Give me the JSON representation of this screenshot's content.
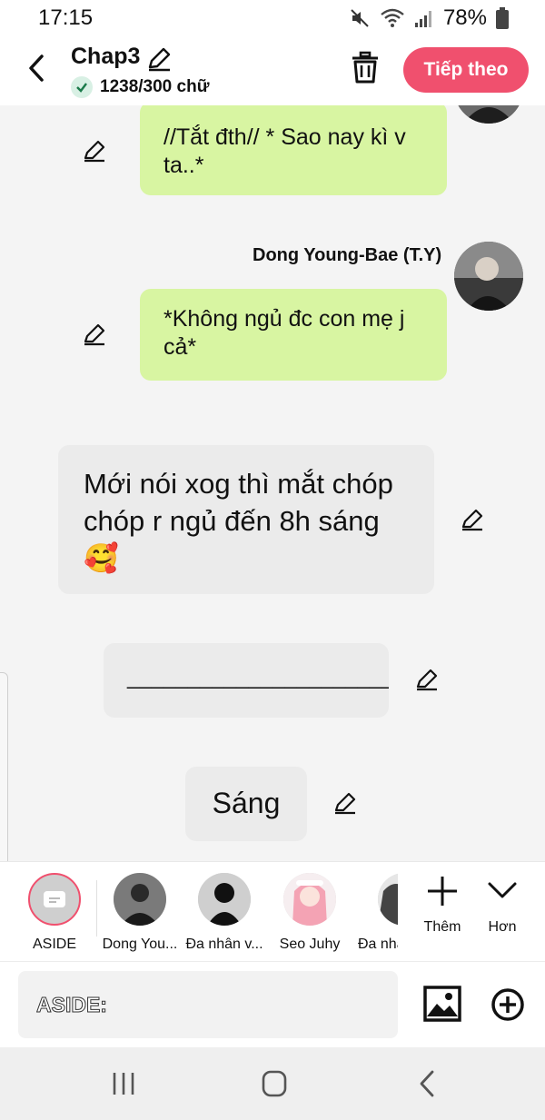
{
  "status": {
    "time": "17:15",
    "battery": "78%"
  },
  "header": {
    "title": "Chap3",
    "word_count": "1238/300 chữ",
    "next_label": "Tiếp theo"
  },
  "messages": [
    {
      "text": "//Tắt đth// * Sao nay kì v ta..*"
    },
    {
      "speaker": "Dong Young-Bae (T.Y)",
      "text": "*Không ngủ đc con mẹ j cả*"
    },
    {
      "text": "Mới nói xog thì mắt chóp chóp r ngủ đến 8h sáng🥰"
    },
    {
      "text": "_________________________"
    },
    {
      "text": "Sáng"
    }
  ],
  "characters": [
    {
      "label": "ASIDE"
    },
    {
      "label": "Dong You..."
    },
    {
      "label": "Đa nhân v..."
    },
    {
      "label": "Seo Juhy"
    },
    {
      "label": "Đa nhâ"
    }
  ],
  "strip_actions": {
    "add_label": "Thêm",
    "more_label": "Hơn"
  },
  "input": {
    "placeholder": "ASIDE:"
  },
  "colors": {
    "accent": "#f0506e",
    "bubble_green": "#d8f5a2",
    "bubble_grey": "#ebebeb"
  }
}
